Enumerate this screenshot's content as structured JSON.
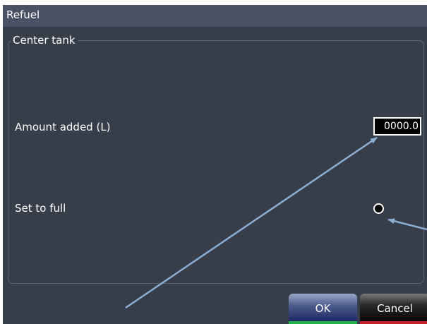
{
  "dialog": {
    "title": "Refuel"
  },
  "group": {
    "legend": "Center tank"
  },
  "amount": {
    "label": "Amount added (L)",
    "value": "0000.0"
  },
  "set_full": {
    "label": "Set to full",
    "selected": false
  },
  "buttons": {
    "ok_label": "OK",
    "cancel_label": "Cancel"
  },
  "colors": {
    "dialog_background": "#383d4a",
    "title_bar": "#4b5164",
    "ok_accent": "#22b24a",
    "cancel_accent": "#c4212a",
    "annotation_arrow": "#8aaed4"
  }
}
